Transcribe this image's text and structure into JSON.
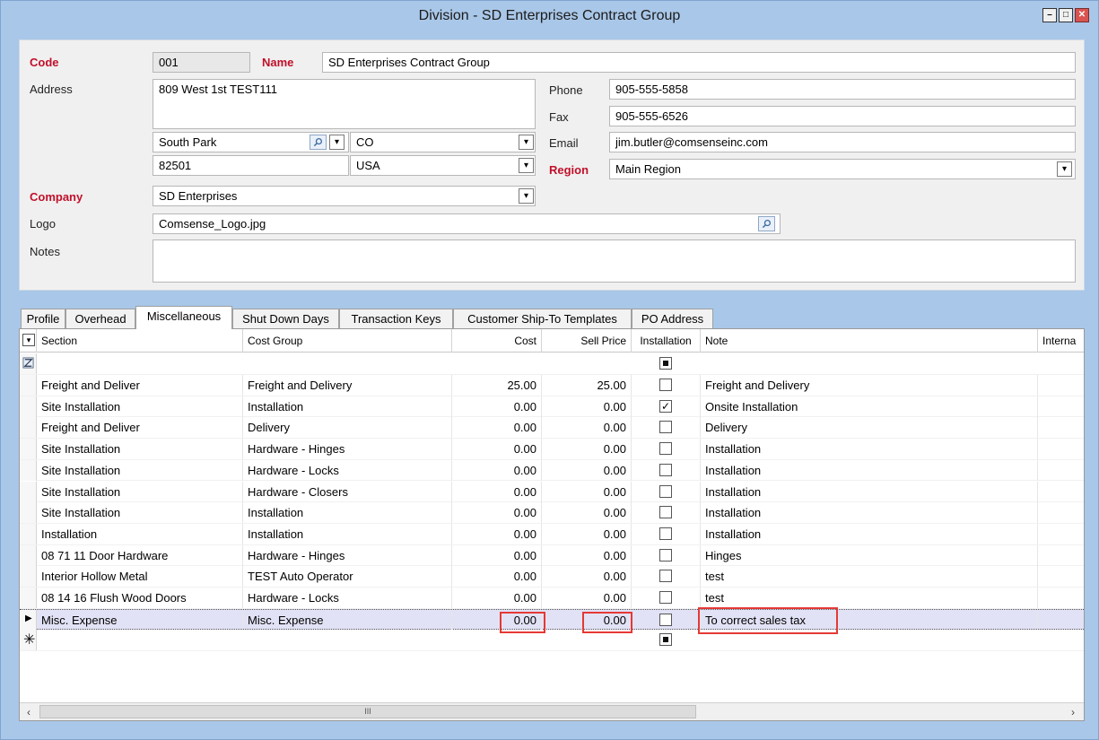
{
  "window": {
    "title": "Division - SD Enterprises Contract Group",
    "controls": {
      "minimize": "–",
      "maximize": "□",
      "close": "✕"
    }
  },
  "form": {
    "code_label": "Code",
    "code": "001",
    "name_label": "Name",
    "name": "SD Enterprises Contract Group",
    "address_label": "Address",
    "address": "809 West 1st TEST111",
    "city": "South Park",
    "state": "CO",
    "zip": "82501",
    "country": "USA",
    "phone_label": "Phone",
    "phone": "905-555-5858",
    "fax_label": "Fax",
    "fax": "905-555-6526",
    "email_label": "Email",
    "email": "jim.butler@comsenseinc.com",
    "region_label": "Region",
    "region": "Main Region",
    "company_label": "Company",
    "company": "SD Enterprises",
    "logo_label": "Logo",
    "logo": "Comsense_Logo.jpg",
    "notes_label": "Notes",
    "notes": ""
  },
  "tabs": [
    "Profile",
    "Overhead",
    "Miscellaneous",
    "Shut Down Days",
    "Transaction Keys",
    "Customer Ship-To Templates",
    "PO Address"
  ],
  "grid": {
    "columns": [
      "Section",
      "Cost Group",
      "Cost",
      "Sell Price",
      "Installation",
      "Note",
      "Interna"
    ],
    "rows": [
      {
        "section": "Freight and Deliver",
        "cost_group": "Freight and Delivery",
        "cost": "25.00",
        "sell": "25.00",
        "install": false,
        "note": "Freight and Delivery"
      },
      {
        "section": "Site Installation",
        "cost_group": "Installation",
        "cost": "0.00",
        "sell": "0.00",
        "install": true,
        "note": "Onsite Installation"
      },
      {
        "section": "Freight and Deliver",
        "cost_group": "Delivery",
        "cost": "0.00",
        "sell": "0.00",
        "install": false,
        "note": "Delivery"
      },
      {
        "section": "Site Installation",
        "cost_group": "Hardware - Hinges",
        "cost": "0.00",
        "sell": "0.00",
        "install": false,
        "note": "Installation"
      },
      {
        "section": "Site Installation",
        "cost_group": "Hardware - Locks",
        "cost": "0.00",
        "sell": "0.00",
        "install": false,
        "note": "Installation"
      },
      {
        "section": "Site Installation",
        "cost_group": "Hardware - Closers",
        "cost": "0.00",
        "sell": "0.00",
        "install": false,
        "note": "Installation"
      },
      {
        "section": "Site Installation",
        "cost_group": "Installation",
        "cost": "0.00",
        "sell": "0.00",
        "install": false,
        "note": "Installation"
      },
      {
        "section": "Installation",
        "cost_group": "Installation",
        "cost": "0.00",
        "sell": "0.00",
        "install": false,
        "note": "Installation"
      },
      {
        "section": "08 71 11 Door Hardware",
        "cost_group": "Hardware - Hinges",
        "cost": "0.00",
        "sell": "0.00",
        "install": false,
        "note": "Hinges"
      },
      {
        "section": "Interior Hollow Metal",
        "cost_group": "TEST Auto Operator",
        "cost": "0.00",
        "sell": "0.00",
        "install": false,
        "note": "test"
      },
      {
        "section": "08 14 16 Flush Wood Doors",
        "cost_group": "Hardware - Locks",
        "cost": "0.00",
        "sell": "0.00",
        "install": false,
        "note": "test"
      },
      {
        "section": "Misc. Expense",
        "cost_group": "Misc. Expense",
        "cost": "0.00",
        "sell": "0.00",
        "install": false,
        "note": "To correct sales tax"
      }
    ],
    "scroll_thumb": "III"
  }
}
